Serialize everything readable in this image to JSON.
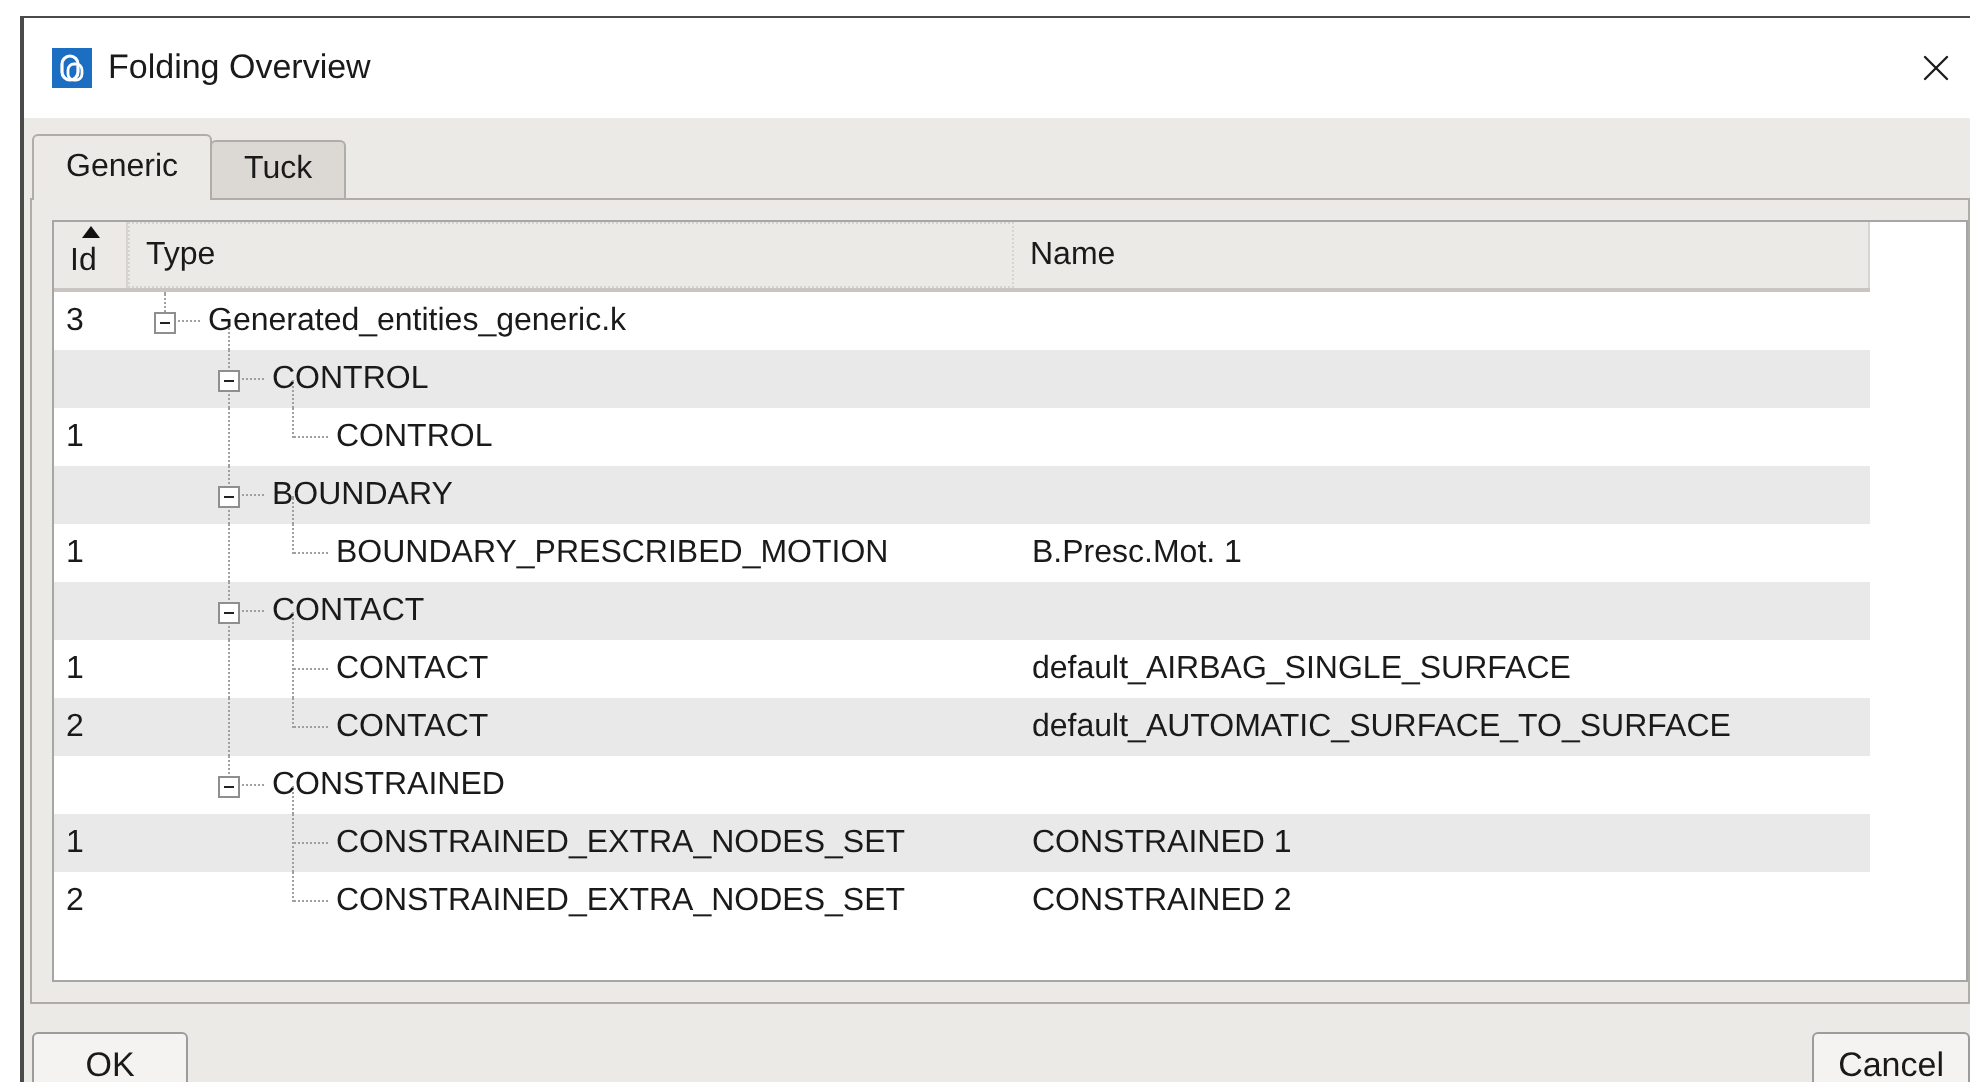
{
  "window": {
    "title": "Folding Overview"
  },
  "tabs": [
    {
      "label": "Generic",
      "selected": true
    },
    {
      "label": "Tuck",
      "selected": false
    }
  ],
  "tree": {
    "columns": [
      {
        "label": "Id",
        "sorted": true,
        "focused": false
      },
      {
        "label": "Type",
        "sorted": false,
        "focused": true
      },
      {
        "label": "Name",
        "sorted": false,
        "focused": false
      }
    ],
    "rows": [
      {
        "id": "3",
        "type": "Generated_entities_generic.k",
        "expanded": true,
        "children": [
          {
            "type": "CONTROL",
            "expanded": true,
            "children": [
              {
                "id": "1",
                "type": "CONTROL"
              }
            ]
          },
          {
            "type": "BOUNDARY",
            "expanded": true,
            "children": [
              {
                "id": "1",
                "type": "BOUNDARY_PRESCRIBED_MOTION",
                "name": "B.Presc.Mot. 1"
              }
            ]
          },
          {
            "type": "CONTACT",
            "expanded": true,
            "children": [
              {
                "id": "1",
                "type": "CONTACT",
                "name": "default_AIRBAG_SINGLE_SURFACE"
              },
              {
                "id": "2",
                "type": "CONTACT",
                "name": "default_AUTOMATIC_SURFACE_TO_SURFACE"
              }
            ]
          },
          {
            "type": "CONSTRAINED",
            "expanded": true,
            "children": [
              {
                "id": "1",
                "type": "CONSTRAINED_EXTRA_NODES_SET",
                "name": "CONSTRAINED 1"
              },
              {
                "id": "2",
                "type": "CONSTRAINED_EXTRA_NODES_SET",
                "name": "CONSTRAINED 2"
              }
            ]
          }
        ]
      }
    ]
  },
  "buttons": [
    "OK",
    "Cancel"
  ]
}
